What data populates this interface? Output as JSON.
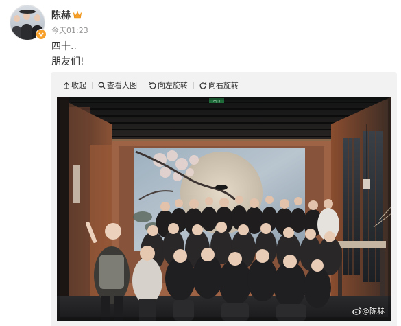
{
  "post": {
    "author": "陈赫",
    "time": "今天01:23",
    "lines": [
      "四十..",
      "朋友们!"
    ]
  },
  "toolbar": {
    "collapse": "收起",
    "view_large": "查看大图",
    "rotate_left": "向左旋转",
    "rotate_right": "向右旋转"
  },
  "photo": {
    "watermark": "@陈赫",
    "exit_sign": "出口"
  },
  "icons": {
    "crown": "crown-icon",
    "verified": "verified-badge-icon",
    "collapse": "arrow-up-icon",
    "search": "search-icon",
    "rotate_left": "rotate-left-icon",
    "rotate_right": "rotate-right-icon",
    "weibo": "weibo-logo-icon"
  },
  "colors": {
    "accent": "#f7a12b",
    "name": "#333333",
    "meta": "#939393",
    "media_bg": "#f2f2f2"
  }
}
